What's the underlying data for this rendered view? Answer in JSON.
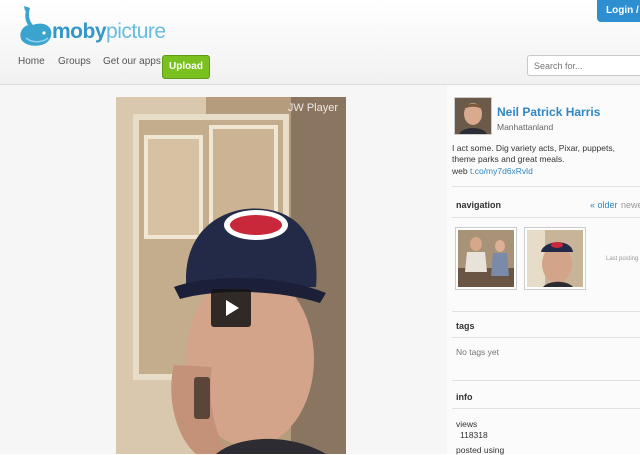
{
  "header": {
    "logo_text_bold": "moby",
    "logo_text_light": "picture",
    "login_label": "Login / S",
    "upload_label": "Upload",
    "search_placeholder": "Search for..."
  },
  "nav": {
    "items": [
      {
        "label": "Home"
      },
      {
        "label": "Groups"
      },
      {
        "label": "Get our apps"
      }
    ]
  },
  "player": {
    "brand": "JW Player"
  },
  "profile": {
    "name": "Neil Patrick Harris",
    "location": "Manhattanland",
    "bio": "I act some. Dig variety acts, Pixar, puppets, theme parks and great meals.",
    "web_label": "web",
    "web_link": "t.co/my7d6xRvld"
  },
  "navigation": {
    "title": "navigation",
    "older_label": "« older",
    "newer_label": "newe",
    "last_posting": "Last posting"
  },
  "tags": {
    "title": "tags",
    "empty_text": "No tags yet"
  },
  "info": {
    "title": "info",
    "views_label": "views",
    "views_value": "118318",
    "posted_label": "posted using"
  },
  "colors": {
    "brand_blue": "#3187c2",
    "upload_green": "#7ac11f",
    "login_blue": "#2d8fcf"
  }
}
